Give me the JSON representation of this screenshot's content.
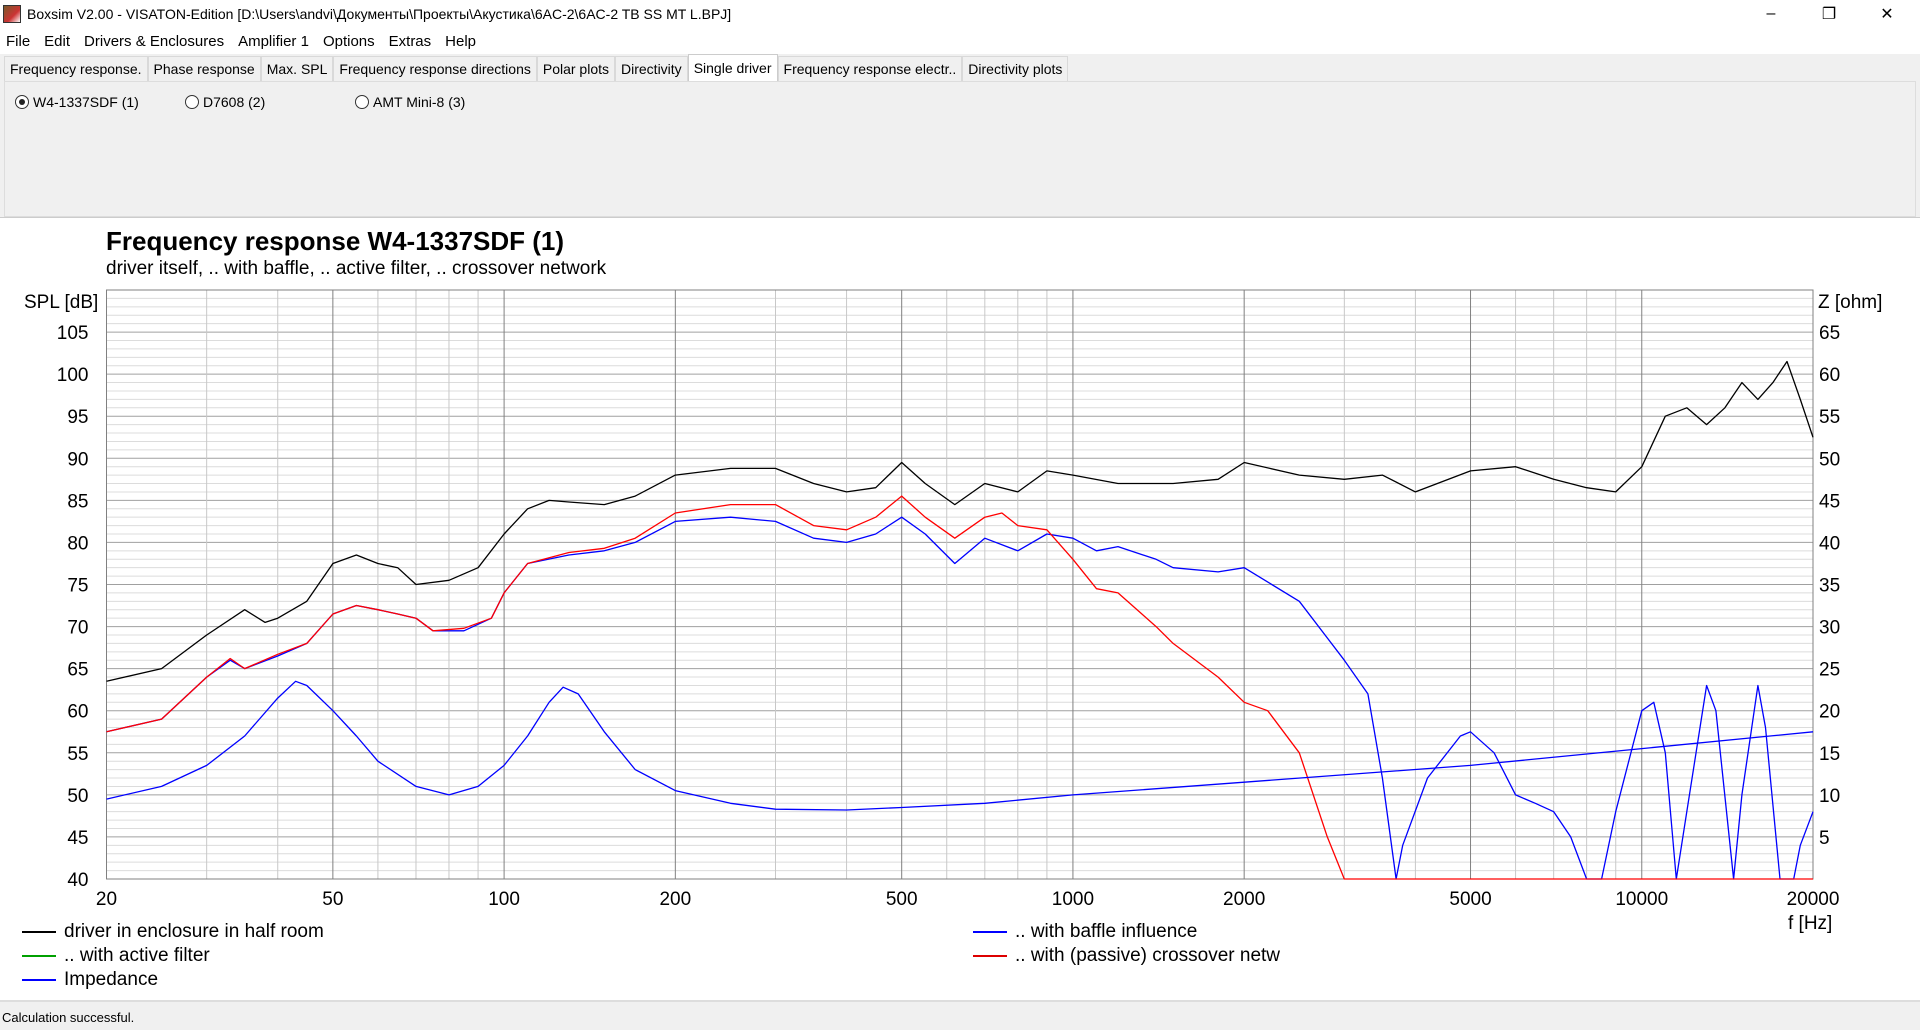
{
  "window": {
    "title": "Boxsim V2.00 - VISATON-Edition [D:\\Users\\andvi\\Документы\\Проекты\\Акустика\\6AC-2\\6AC-2 TB SS MT L.BPJ]",
    "minimize": "–",
    "restore": "❐",
    "close": "✕"
  },
  "menu": [
    "File",
    "Edit",
    "Drivers & Enclosures",
    "Amplifier 1",
    "Options",
    "Extras",
    "Help"
  ],
  "tabs": [
    "Frequency response.",
    "Phase response",
    "Max. SPL",
    "Frequency response directions",
    "Polar plots",
    "Directivity",
    "Single driver",
    "Frequency response electr..",
    "Directivity plots"
  ],
  "active_tab": "Single driver",
  "drivers": [
    {
      "label": "W4-1337SDF (1)",
      "selected": true
    },
    {
      "label": "D7608 (2)",
      "selected": false
    },
    {
      "label": "AMT Mini-8 (3)",
      "selected": false
    }
  ],
  "status": "Calculation successful.",
  "chart_data": {
    "type": "line",
    "title": "Frequency response W4-1337SDF (1)",
    "subtitle": "driver itself, .. with baffle, .. active filter, .. crossover network",
    "ylabel": "SPL [dB]",
    "y2label": "Z [ohm]",
    "xlabel": "f [Hz]",
    "xlim": [
      20,
      20000
    ],
    "xscale": "log",
    "ylim": [
      40,
      110
    ],
    "y2lim": [
      0,
      70
    ],
    "xticks": [
      20,
      50,
      100,
      200,
      500,
      1000,
      2000,
      5000,
      10000,
      20000
    ],
    "yticks": [
      40,
      45,
      50,
      55,
      60,
      65,
      70,
      75,
      80,
      85,
      90,
      95,
      100,
      105
    ],
    "y2ticks": [
      5,
      10,
      15,
      20,
      25,
      30,
      35,
      40,
      45,
      50,
      55,
      60,
      65
    ],
    "grid": true,
    "series": [
      {
        "name": "driver in enclosure in half room",
        "color": "#000000",
        "axis": "left",
        "points": [
          [
            20,
            63.5
          ],
          [
            25,
            65
          ],
          [
            30,
            69
          ],
          [
            35,
            72
          ],
          [
            38,
            70.5
          ],
          [
            40,
            71
          ],
          [
            45,
            73
          ],
          [
            50,
            77.5
          ],
          [
            55,
            78.5
          ],
          [
            60,
            77.5
          ],
          [
            65,
            77
          ],
          [
            70,
            75
          ],
          [
            80,
            75.5
          ],
          [
            90,
            77
          ],
          [
            100,
            81
          ],
          [
            110,
            84
          ],
          [
            120,
            85
          ],
          [
            130,
            84.8
          ],
          [
            150,
            84.5
          ],
          [
            170,
            85.5
          ],
          [
            200,
            88
          ],
          [
            250,
            88.8
          ],
          [
            300,
            88.8
          ],
          [
            350,
            87
          ],
          [
            400,
            86
          ],
          [
            450,
            86.5
          ],
          [
            500,
            89.5
          ],
          [
            550,
            87
          ],
          [
            620,
            84.5
          ],
          [
            700,
            87
          ],
          [
            800,
            86
          ],
          [
            900,
            88.5
          ],
          [
            1000,
            88
          ],
          [
            1200,
            87
          ],
          [
            1500,
            87
          ],
          [
            1800,
            87.5
          ],
          [
            2000,
            89.5
          ],
          [
            2500,
            88
          ],
          [
            3000,
            87.5
          ],
          [
            3500,
            88
          ],
          [
            4000,
            86
          ],
          [
            5000,
            88.5
          ],
          [
            6000,
            89
          ],
          [
            7000,
            87.5
          ],
          [
            8000,
            86.5
          ],
          [
            9000,
            86
          ],
          [
            10000,
            89
          ],
          [
            11000,
            95
          ],
          [
            12000,
            96
          ],
          [
            13000,
            94
          ],
          [
            14000,
            96
          ],
          [
            15000,
            99
          ],
          [
            16000,
            97
          ],
          [
            17000,
            99
          ],
          [
            18000,
            101.5
          ],
          [
            19000,
            97
          ],
          [
            20000,
            92.5
          ]
        ]
      },
      {
        "name": ".. with baffle influence",
        "color": "#0000ff",
        "axis": "left",
        "points": [
          [
            20,
            57.5
          ],
          [
            25,
            59
          ],
          [
            30,
            64
          ],
          [
            33,
            66
          ],
          [
            35,
            65
          ],
          [
            40,
            66.5
          ],
          [
            45,
            68
          ],
          [
            50,
            71.5
          ],
          [
            55,
            72.5
          ],
          [
            60,
            72
          ],
          [
            65,
            71.5
          ],
          [
            70,
            71
          ],
          [
            75,
            69.5
          ],
          [
            85,
            69.5
          ],
          [
            95,
            71
          ],
          [
            100,
            74
          ],
          [
            110,
            77.5
          ],
          [
            130,
            78.5
          ],
          [
            150,
            79
          ],
          [
            170,
            80
          ],
          [
            200,
            82.5
          ],
          [
            250,
            83
          ],
          [
            300,
            82.5
          ],
          [
            350,
            80.5
          ],
          [
            400,
            80
          ],
          [
            450,
            81
          ],
          [
            500,
            83
          ],
          [
            550,
            81
          ],
          [
            620,
            77.5
          ],
          [
            700,
            80.5
          ],
          [
            800,
            79
          ],
          [
            900,
            81
          ],
          [
            1000,
            80.5
          ],
          [
            1100,
            79
          ],
          [
            1200,
            79.5
          ],
          [
            1400,
            78
          ],
          [
            1500,
            77
          ],
          [
            1800,
            76.5
          ],
          [
            2000,
            77
          ],
          [
            2500,
            73
          ],
          [
            3000,
            66
          ],
          [
            3300,
            62
          ],
          [
            3500,
            52
          ],
          [
            3700,
            40
          ],
          [
            3800,
            44
          ],
          [
            4200,
            52
          ],
          [
            4800,
            57
          ],
          [
            5000,
            57.5
          ],
          [
            5500,
            55
          ],
          [
            6000,
            50
          ],
          [
            6500,
            49
          ],
          [
            7000,
            48
          ],
          [
            7500,
            45
          ],
          [
            8000,
            40
          ],
          [
            8500,
            40
          ],
          [
            9000,
            48
          ],
          [
            10000,
            60
          ],
          [
            10500,
            61
          ],
          [
            11000,
            55
          ],
          [
            11500,
            40
          ],
          [
            12000,
            48
          ],
          [
            13000,
            63
          ],
          [
            13500,
            60
          ],
          [
            14500,
            40
          ],
          [
            15000,
            50
          ],
          [
            16000,
            63
          ],
          [
            16500,
            58
          ],
          [
            17500,
            40
          ],
          [
            18500,
            40
          ],
          [
            19000,
            44
          ],
          [
            20000,
            48
          ]
        ]
      },
      {
        "name": ".. with active filter",
        "color": "#00a000",
        "axis": "left",
        "points": []
      },
      {
        "name": ".. with (passive) crossover netw",
        "color": "#ff0000",
        "axis": "left",
        "points": [
          [
            20,
            57.5
          ],
          [
            25,
            59
          ],
          [
            30,
            64
          ],
          [
            33,
            66.2
          ],
          [
            35,
            65
          ],
          [
            40,
            66.7
          ],
          [
            45,
            68
          ],
          [
            50,
            71.5
          ],
          [
            55,
            72.5
          ],
          [
            60,
            72
          ],
          [
            65,
            71.5
          ],
          [
            70,
            71
          ],
          [
            75,
            69.5
          ],
          [
            85,
            69.8
          ],
          [
            95,
            71
          ],
          [
            100,
            74
          ],
          [
            110,
            77.5
          ],
          [
            130,
            78.8
          ],
          [
            150,
            79.3
          ],
          [
            170,
            80.5
          ],
          [
            200,
            83.5
          ],
          [
            250,
            84.5
          ],
          [
            300,
            84.5
          ],
          [
            350,
            82
          ],
          [
            400,
            81.5
          ],
          [
            450,
            83
          ],
          [
            500,
            85.5
          ],
          [
            550,
            83
          ],
          [
            620,
            80.5
          ],
          [
            700,
            83
          ],
          [
            750,
            83.5
          ],
          [
            800,
            82
          ],
          [
            900,
            81.5
          ],
          [
            1000,
            78
          ],
          [
            1100,
            74.5
          ],
          [
            1200,
            74
          ],
          [
            1400,
            70
          ],
          [
            1500,
            68
          ],
          [
            1800,
            64
          ],
          [
            2000,
            61
          ],
          [
            2200,
            60
          ],
          [
            2500,
            55
          ],
          [
            2800,
            45
          ],
          [
            3000,
            40
          ],
          [
            20000,
            40
          ]
        ]
      },
      {
        "name": "Impedance",
        "color": "#0000ff",
        "axis": "right",
        "points": [
          [
            20,
            9.5
          ],
          [
            25,
            11
          ],
          [
            30,
            13.5
          ],
          [
            35,
            17
          ],
          [
            40,
            21.5
          ],
          [
            43,
            23.5
          ],
          [
            45,
            23
          ],
          [
            50,
            20
          ],
          [
            55,
            17
          ],
          [
            60,
            14
          ],
          [
            70,
            11
          ],
          [
            80,
            10
          ],
          [
            90,
            11
          ],
          [
            100,
            13.5
          ],
          [
            110,
            17
          ],
          [
            120,
            21
          ],
          [
            127,
            22.8
          ],
          [
            135,
            22
          ],
          [
            150,
            17.5
          ],
          [
            170,
            13
          ],
          [
            200,
            10.5
          ],
          [
            250,
            9
          ],
          [
            300,
            8.3
          ],
          [
            400,
            8.2
          ],
          [
            500,
            8.5
          ],
          [
            700,
            9
          ],
          [
            1000,
            10
          ],
          [
            2000,
            11.5
          ],
          [
            5000,
            13.5
          ],
          [
            10000,
            15.5
          ],
          [
            20000,
            17.5
          ]
        ]
      }
    ],
    "legend": [
      {
        "label": "driver in enclosure in half room",
        "color": "#000000"
      },
      {
        "label": ".. with active filter",
        "color": "#00a000"
      },
      {
        "label": "Impedance",
        "color": "#0000ff"
      },
      {
        "label": ".. with baffle influence",
        "color": "#0000ff"
      },
      {
        "label": ".. with (passive) crossover netw",
        "color": "#ff0000"
      }
    ]
  }
}
